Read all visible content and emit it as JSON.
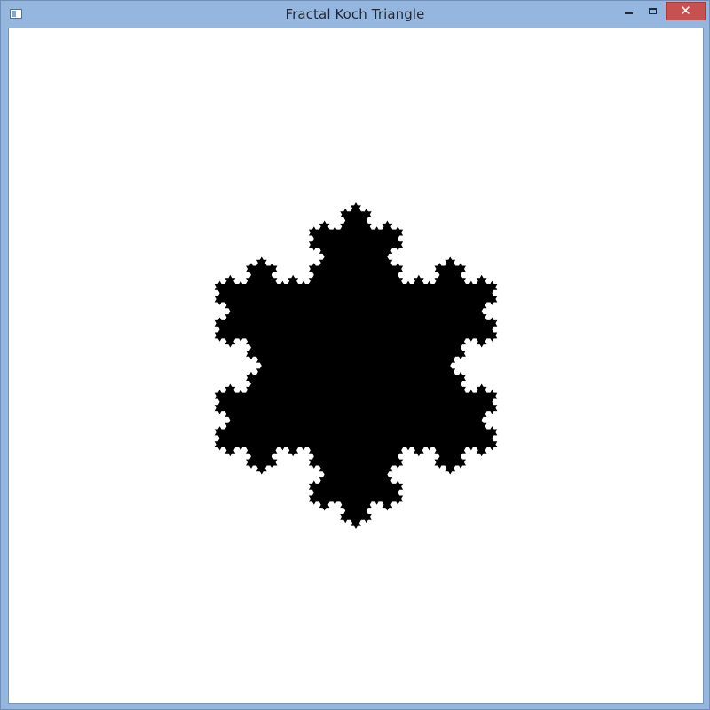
{
  "window": {
    "title": "Fractal Koch Triangle",
    "controls": {
      "minimize_icon": "minimize-icon",
      "maximize_icon": "maximize-icon",
      "close_icon": "close-icon",
      "close_glyph": "✕"
    }
  },
  "canvas": {
    "background": "#ffffff",
    "fill_color": "#000000",
    "shape": "koch-snowflake"
  }
}
